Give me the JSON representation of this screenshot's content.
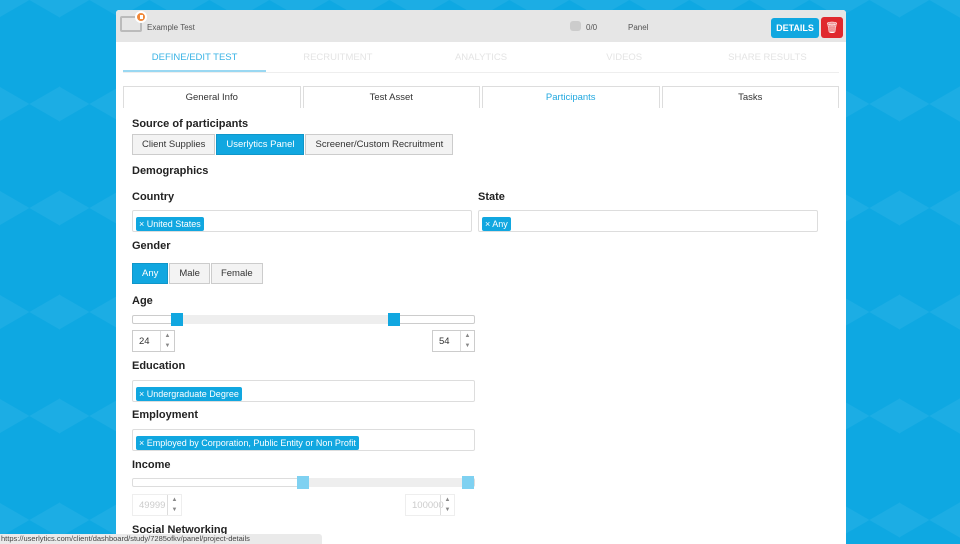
{
  "header": {
    "title": "Example Test",
    "participants": "0/0",
    "type": "Panel",
    "details_label": "DETAILS"
  },
  "tabs": [
    "DEFINE/EDIT TEST",
    "RECRUITMENT",
    "ANALYTICS",
    "VIDEOS",
    "SHARE RESULTS"
  ],
  "subtabs": [
    "General Info",
    "Test Asset",
    "Participants",
    "Tasks"
  ],
  "source": {
    "label": "Source of participants",
    "options": [
      "Client Supplies",
      "Userlytics Panel",
      "Screener/Custom Recruitment"
    ],
    "selected": "Userlytics Panel"
  },
  "demographics": "Demographics",
  "country": {
    "label": "Country",
    "tags": [
      "United States"
    ]
  },
  "state": {
    "label": "State",
    "tags": [
      "Any"
    ]
  },
  "gender": {
    "label": "Gender",
    "options": [
      "Any",
      "Male",
      "Female"
    ],
    "selected": "Any"
  },
  "age": {
    "label": "Age",
    "min_value": "24",
    "max_value": "54",
    "range_min": 18,
    "range_max": 65
  },
  "education": {
    "label": "Education",
    "tags": [
      "Undergraduate Degree"
    ]
  },
  "employment": {
    "label": "Employment",
    "tags": [
      "Employed by Corporation, Public Entity or Non Profit"
    ]
  },
  "income": {
    "label": "Income",
    "min_value": "49999",
    "max_value": "100000",
    "range_min": 0,
    "range_max": 100000
  },
  "social": {
    "label": "Social Networking"
  },
  "status_url": "https://userlytics.com/client/dashboard/study/7285ofkv/panel/project-details"
}
